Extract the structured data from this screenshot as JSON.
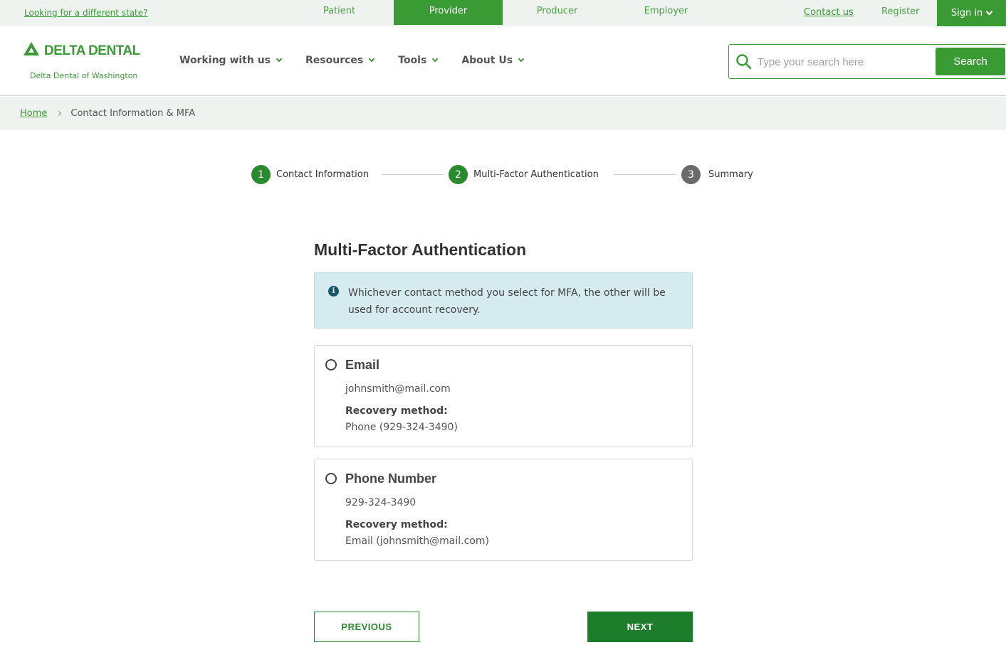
{
  "topbar": {
    "state_link": "Looking for a different state?",
    "audiences": [
      "Patient",
      "Provider",
      "Producer",
      "Employer"
    ],
    "active_audience": "Provider",
    "contact_link": "Contact us",
    "register_label": "Register",
    "signin_label": "Sign in"
  },
  "header": {
    "brand": "DELTA DENTAL",
    "brand_sub": "Delta Dental of Washington",
    "nav": [
      "Working with us",
      "Resources",
      "Tools",
      "About Us"
    ],
    "search_placeholder": "Type your search here",
    "search_button": "Search"
  },
  "breadcrumb": {
    "home": "Home",
    "current": "Contact Information & MFA"
  },
  "stepper": [
    {
      "number": "1",
      "label": "Contact Information",
      "state": "done"
    },
    {
      "number": "2",
      "label": "Multi-Factor Authentication",
      "state": "done"
    },
    {
      "number": "3",
      "label": "Summary",
      "state": "todo"
    }
  ],
  "main": {
    "title": "Multi-Factor Authentication",
    "info": "Whichever contact method you select for MFA, the other will be used for account recovery.",
    "options": [
      {
        "title": "Email",
        "value": "johnsmith@mail.com",
        "recovery_label": "Recovery method:",
        "recovery_value": "Phone (929-324-3490)",
        "selected": false
      },
      {
        "title": "Phone Number",
        "value": "929-324-3490",
        "recovery_label": "Recovery method:",
        "recovery_value": "Email (johnsmith@mail.com)",
        "selected": false
      }
    ],
    "previous_label": "PREVIOUS",
    "next_label": "NEXT"
  },
  "colors": {
    "brand_green": "#3a9b35",
    "dark_green": "#1e7d2a",
    "info_bg": "#d5ebef",
    "info_icon": "#16576a",
    "topbar_bg": "#eef3ef"
  }
}
